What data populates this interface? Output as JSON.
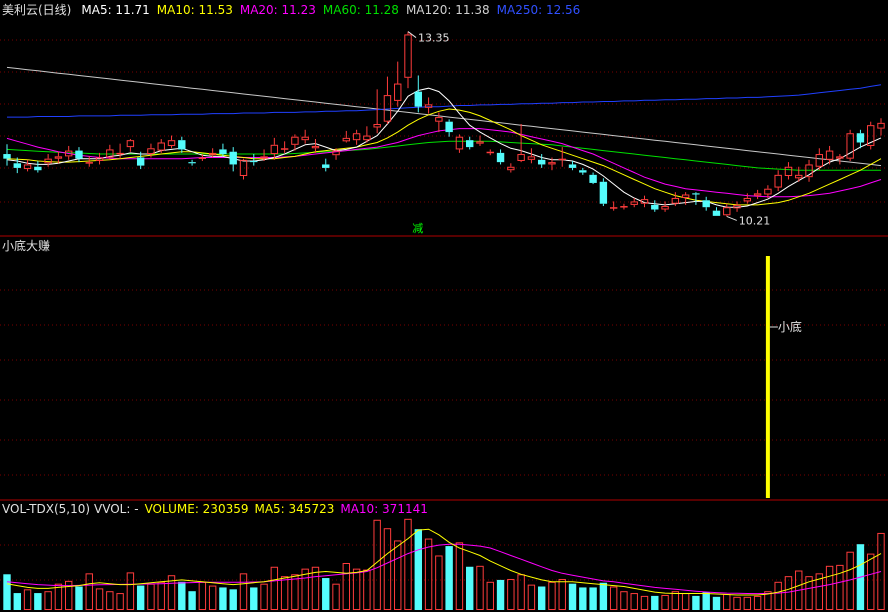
{
  "panel1": {
    "title": "美利云(日线)",
    "ma5": "MA5: 11.71",
    "ma10": "MA10: 11.53",
    "ma20": "MA20: 11.23",
    "ma60": "MA60: 11.28",
    "ma120": "MA120: 11.38",
    "ma250": "MA250: 12.56",
    "high_label": "13.35",
    "low_label": "10.21",
    "marker": "减"
  },
  "panel2": {
    "title": "小底大赚",
    "signal_label": "小底"
  },
  "panel3": {
    "name": "VOL-TDX(5,10)",
    "vvol": "VVOL: -",
    "volume": "VOLUME: 230359",
    "ma5": "MA5: 345723",
    "ma10": "MA10: 371141"
  },
  "colors": {
    "up": "#ff3c3c",
    "down": "#54fcfc",
    "ma5": "#ffffff",
    "ma10": "#ffff00",
    "ma20": "#ff00ff",
    "ma60": "#00e000",
    "ma120": "#c8c8c8",
    "ma250": "#2040ff",
    "signal": "#ffff00",
    "marker": "#00ff00",
    "border": "#b00000"
  },
  "chart_data": {
    "type": "candlestick",
    "price_range": [
      10.0,
      13.6
    ],
    "candles": [
      [
        11.28,
        11.2,
        11.45,
        11.08
      ],
      [
        11.12,
        11.04,
        11.22,
        10.95
      ],
      [
        11.02,
        11.1,
        11.18,
        10.98
      ],
      [
        11.06,
        11.0,
        11.16,
        10.96
      ],
      [
        11.12,
        11.2,
        11.28,
        11.06
      ],
      [
        11.2,
        11.24,
        11.32,
        11.12
      ],
      [
        11.24,
        11.34,
        11.42,
        11.18
      ],
      [
        11.34,
        11.2,
        11.4,
        11.14
      ],
      [
        11.12,
        11.14,
        11.24,
        11.06
      ],
      [
        11.16,
        11.22,
        11.3,
        11.1
      ],
      [
        11.22,
        11.36,
        11.44,
        11.18
      ],
      [
        11.3,
        11.3,
        11.46,
        11.2
      ],
      [
        11.4,
        11.52,
        11.54,
        11.32
      ],
      [
        11.22,
        11.08,
        11.32,
        11.02
      ],
      [
        11.28,
        11.38,
        11.46,
        11.22
      ],
      [
        11.34,
        11.48,
        11.54,
        11.3
      ],
      [
        11.42,
        11.52,
        11.6,
        11.38
      ],
      [
        11.52,
        11.36,
        11.58,
        11.3
      ],
      [
        11.14,
        11.12,
        11.18,
        11.08
      ],
      [
        11.2,
        11.22,
        11.28,
        11.16
      ],
      [
        11.26,
        11.3,
        11.38,
        11.22
      ],
      [
        11.36,
        11.28,
        11.46,
        11.24
      ],
      [
        11.32,
        11.1,
        11.4,
        10.98
      ],
      [
        10.9,
        11.18,
        11.2,
        10.84
      ],
      [
        11.16,
        11.14,
        11.28,
        11.08
      ],
      [
        11.2,
        11.24,
        11.36,
        11.16
      ],
      [
        11.28,
        11.44,
        11.56,
        11.18
      ],
      [
        11.38,
        11.38,
        11.5,
        11.3
      ],
      [
        11.44,
        11.58,
        11.62,
        11.34
      ],
      [
        11.52,
        11.58,
        11.7,
        11.46
      ],
      [
        11.38,
        11.42,
        11.54,
        11.3
      ],
      [
        11.1,
        11.04,
        11.2,
        10.98
      ],
      [
        11.26,
        11.34,
        11.38,
        11.18
      ],
      [
        11.5,
        11.56,
        11.68,
        11.48
      ],
      [
        11.52,
        11.64,
        11.7,
        11.44
      ],
      [
        11.52,
        11.6,
        11.76,
        11.48
      ],
      [
        11.74,
        11.8,
        12.4,
        11.64
      ],
      [
        11.84,
        12.3,
        12.62,
        11.8
      ],
      [
        12.2,
        12.5,
        12.88,
        12.1
      ],
      [
        12.6,
        13.35,
        13.4,
        12.42
      ],
      [
        12.36,
        12.1,
        12.64,
        12.0
      ],
      [
        12.08,
        12.14,
        12.26,
        11.98
      ],
      [
        11.84,
        11.92,
        12.0,
        11.66
      ],
      [
        11.84,
        11.66,
        11.88,
        11.58
      ],
      [
        11.36,
        11.58,
        11.62,
        11.3
      ],
      [
        11.52,
        11.4,
        11.58,
        11.36
      ],
      [
        11.46,
        11.5,
        11.6,
        11.42
      ],
      [
        11.3,
        11.32,
        11.36,
        11.26
      ],
      [
        11.3,
        11.14,
        11.36,
        11.1
      ],
      [
        11.0,
        11.06,
        11.12,
        10.96
      ],
      [
        11.16,
        11.28,
        11.8,
        11.14
      ],
      [
        11.18,
        11.24,
        11.38,
        11.12
      ],
      [
        11.18,
        11.1,
        11.28,
        11.04
      ],
      [
        11.1,
        11.14,
        11.22,
        11.0
      ],
      [
        11.2,
        11.2,
        11.4,
        11.06
      ],
      [
        11.1,
        11.04,
        11.16,
        11.0
      ],
      [
        11.0,
        10.96,
        11.04,
        10.92
      ],
      [
        10.92,
        10.78,
        10.96,
        10.76
      ],
      [
        10.8,
        10.42,
        10.86,
        10.38
      ],
      [
        10.36,
        10.36,
        10.46,
        10.3
      ],
      [
        10.36,
        10.38,
        10.42,
        10.32
      ],
      [
        10.4,
        10.46,
        10.52,
        10.36
      ],
      [
        10.42,
        10.5,
        10.56,
        10.36
      ],
      [
        10.4,
        10.32,
        10.48,
        10.28
      ],
      [
        10.32,
        10.38,
        10.46,
        10.28
      ],
      [
        10.42,
        10.52,
        10.62,
        10.38
      ],
      [
        10.52,
        10.58,
        10.62,
        10.4
      ],
      [
        10.6,
        10.58,
        10.62,
        10.4
      ],
      [
        10.48,
        10.36,
        10.54,
        10.3
      ],
      [
        10.3,
        10.21,
        10.36,
        10.21
      ],
      [
        10.22,
        10.36,
        10.42,
        10.2
      ],
      [
        10.34,
        10.4,
        10.46,
        10.28
      ],
      [
        10.46,
        10.52,
        10.6,
        10.42
      ],
      [
        10.56,
        10.6,
        10.66,
        10.5
      ],
      [
        10.58,
        10.68,
        10.74,
        10.52
      ],
      [
        10.7,
        10.92,
        11.0,
        10.64
      ],
      [
        10.9,
        11.06,
        11.14,
        10.84
      ],
      [
        10.86,
        10.92,
        11.06,
        10.8
      ],
      [
        10.88,
        11.1,
        11.18,
        10.8
      ],
      [
        11.06,
        11.28,
        11.38,
        11.0
      ],
      [
        11.18,
        11.34,
        11.42,
        11.1
      ],
      [
        11.2,
        11.24,
        11.28,
        11.1
      ],
      [
        11.2,
        11.64,
        11.7,
        11.16
      ],
      [
        11.64,
        11.48,
        11.7,
        11.38
      ],
      [
        11.42,
        11.78,
        11.84,
        11.36
      ],
      [
        11.72,
        11.82,
        11.9,
        11.6
      ]
    ],
    "ma5": [
      11.18,
      11.16,
      11.12,
      11.1,
      11.1,
      11.12,
      11.16,
      11.2,
      11.2,
      11.2,
      11.24,
      11.26,
      11.3,
      11.28,
      11.28,
      11.34,
      11.36,
      11.38,
      11.32,
      11.26,
      11.24,
      11.24,
      11.2,
      11.16,
      11.16,
      11.18,
      11.22,
      11.28,
      11.36,
      11.44,
      11.46,
      11.4,
      11.34,
      11.36,
      11.4,
      11.5,
      11.6,
      11.8,
      12.02,
      12.28,
      12.38,
      12.42,
      12.36,
      12.2,
      11.98,
      11.78,
      11.66,
      11.56,
      11.46,
      11.38,
      11.34,
      11.28,
      11.22,
      11.18,
      11.18,
      11.16,
      11.1,
      11.02,
      10.9,
      10.76,
      10.62,
      10.52,
      10.44,
      10.42,
      10.4,
      10.42,
      10.44,
      10.46,
      10.46,
      10.4,
      10.36,
      10.36,
      10.38,
      10.44,
      10.5,
      10.6,
      10.72,
      10.82,
      10.92,
      11.04,
      11.14,
      11.2,
      11.3,
      11.4,
      11.48,
      11.56
    ],
    "ma10": [
      11.2,
      11.19,
      11.18,
      11.16,
      11.15,
      11.14,
      11.14,
      11.15,
      11.16,
      11.17,
      11.18,
      11.2,
      11.22,
      11.24,
      11.26,
      11.28,
      11.3,
      11.32,
      11.32,
      11.3,
      11.28,
      11.26,
      11.24,
      11.22,
      11.2,
      11.2,
      11.2,
      11.22,
      11.24,
      11.28,
      11.32,
      11.34,
      11.36,
      11.38,
      11.4,
      11.44,
      11.48,
      11.56,
      11.66,
      11.78,
      11.88,
      11.96,
      12.02,
      12.06,
      12.04,
      12.0,
      11.94,
      11.86,
      11.78,
      11.7,
      11.6,
      11.52,
      11.44,
      11.38,
      11.32,
      11.26,
      11.2,
      11.14,
      11.08,
      11.0,
      10.92,
      10.84,
      10.76,
      10.68,
      10.62,
      10.56,
      10.52,
      10.48,
      10.46,
      10.44,
      10.42,
      10.4,
      10.4,
      10.4,
      10.42,
      10.44,
      10.48,
      10.54,
      10.6,
      10.68,
      10.76,
      10.84,
      10.92,
      11.0,
      11.1,
      11.2
    ],
    "ma20": [
      11.55,
      11.5,
      11.45,
      11.4,
      11.36,
      11.32,
      11.29,
      11.26,
      11.24,
      11.22,
      11.21,
      11.2,
      11.2,
      11.2,
      11.2,
      11.2,
      11.2,
      11.2,
      11.21,
      11.22,
      11.22,
      11.22,
      11.22,
      11.22,
      11.22,
      11.22,
      11.22,
      11.23,
      11.24,
      11.26,
      11.28,
      11.3,
      11.32,
      11.34,
      11.36,
      11.38,
      11.4,
      11.44,
      11.48,
      11.54,
      11.6,
      11.64,
      11.68,
      11.7,
      11.72,
      11.72,
      11.72,
      11.7,
      11.68,
      11.66,
      11.62,
      11.58,
      11.54,
      11.5,
      11.46,
      11.4,
      11.34,
      11.28,
      11.2,
      11.12,
      11.04,
      10.96,
      10.88,
      10.82,
      10.76,
      10.72,
      10.68,
      10.66,
      10.64,
      10.62,
      10.6,
      10.58,
      10.56,
      10.55,
      10.54,
      10.54,
      10.54,
      10.55,
      10.56,
      10.58,
      10.6,
      10.64,
      10.68,
      10.72,
      10.78,
      10.84
    ],
    "ma60": [
      11.36,
      11.35,
      11.34,
      11.33,
      11.32,
      11.31,
      11.3,
      11.3,
      11.29,
      11.28,
      11.28,
      11.28,
      11.28,
      11.28,
      11.28,
      11.28,
      11.28,
      11.28,
      11.28,
      11.28,
      11.28,
      11.28,
      11.28,
      11.28,
      11.28,
      11.28,
      11.28,
      11.28,
      11.29,
      11.3,
      11.31,
      11.32,
      11.33,
      11.34,
      11.35,
      11.36,
      11.38,
      11.4,
      11.42,
      11.44,
      11.46,
      11.48,
      11.49,
      11.5,
      11.5,
      11.5,
      11.5,
      11.5,
      11.49,
      11.48,
      11.47,
      11.46,
      11.45,
      11.44,
      11.42,
      11.4,
      11.38,
      11.36,
      11.34,
      11.32,
      11.3,
      11.28,
      11.26,
      11.24,
      11.22,
      11.2,
      11.18,
      11.16,
      11.14,
      11.12,
      11.1,
      11.08,
      11.06,
      11.04,
      11.03,
      11.02,
      11.01,
      11.0,
      11.0,
      11.0,
      11.0,
      11.0,
      11.0,
      11.0,
      11.0,
      11.0
    ],
    "ma120": [
      12.78,
      12.76,
      12.74,
      12.72,
      12.7,
      12.68,
      12.66,
      12.64,
      12.62,
      12.6,
      12.58,
      12.56,
      12.54,
      12.52,
      12.5,
      12.48,
      12.46,
      12.44,
      12.42,
      12.4,
      12.38,
      12.36,
      12.34,
      12.32,
      12.3,
      12.28,
      12.26,
      12.24,
      12.22,
      12.2,
      12.18,
      12.16,
      12.14,
      12.12,
      12.1,
      12.08,
      12.06,
      12.04,
      12.02,
      12.0,
      11.98,
      11.96,
      11.94,
      11.92,
      11.9,
      11.88,
      11.86,
      11.84,
      11.82,
      11.8,
      11.78,
      11.76,
      11.74,
      11.72,
      11.7,
      11.68,
      11.66,
      11.64,
      11.62,
      11.6,
      11.58,
      11.56,
      11.54,
      11.52,
      11.5,
      11.48,
      11.46,
      11.44,
      11.42,
      11.4,
      11.38,
      11.36,
      11.34,
      11.32,
      11.3,
      11.28,
      11.26,
      11.24,
      11.22,
      11.2,
      11.18,
      11.16,
      11.14,
      11.12,
      11.1,
      11.08
    ],
    "ma250": [
      11.92,
      11.92,
      11.92,
      11.93,
      11.93,
      11.93,
      11.93,
      11.94,
      11.94,
      11.94,
      11.94,
      11.95,
      11.95,
      11.95,
      11.96,
      11.96,
      11.96,
      11.97,
      11.97,
      11.97,
      11.98,
      11.98,
      11.98,
      11.99,
      11.99,
      11.99,
      12.0,
      12.0,
      12.0,
      12.01,
      12.01,
      12.02,
      12.02,
      12.03,
      12.03,
      12.04,
      12.05,
      12.06,
      12.07,
      12.08,
      12.09,
      12.1,
      12.1,
      12.11,
      12.12,
      12.12,
      12.13,
      12.13,
      12.14,
      12.14,
      12.15,
      12.15,
      12.16,
      12.16,
      12.17,
      12.17,
      12.18,
      12.18,
      12.19,
      12.19,
      12.2,
      12.2,
      12.21,
      12.21,
      12.22,
      12.22,
      12.23,
      12.23,
      12.24,
      12.24,
      12.25,
      12.25,
      12.26,
      12.26,
      12.27,
      12.28,
      12.29,
      12.3,
      12.32,
      12.34,
      12.36,
      12.38,
      12.4,
      12.42,
      12.45,
      12.48
    ],
    "signal_index": 74,
    "marker_index": 40,
    "volume_range": [
      0,
      1000000
    ],
    "volume": [
      380000,
      180000,
      220000,
      180000,
      200000,
      280000,
      310000,
      250000,
      390000,
      230000,
      200000,
      180000,
      400000,
      260000,
      280000,
      300000,
      370000,
      300000,
      200000,
      300000,
      260000,
      240000,
      220000,
      390000,
      240000,
      280000,
      460000,
      360000,
      380000,
      440000,
      460000,
      340000,
      280000,
      500000,
      440000,
      430000,
      960000,
      870000,
      740000,
      970000,
      860000,
      760000,
      580000,
      680000,
      720000,
      460000,
      470000,
      300000,
      320000,
      330000,
      380000,
      270000,
      250000,
      300000,
      330000,
      280000,
      240000,
      240000,
      290000,
      250000,
      200000,
      180000,
      150000,
      150000,
      160000,
      200000,
      180000,
      150000,
      190000,
      140000,
      170000,
      140000,
      140000,
      150000,
      200000,
      300000,
      360000,
      420000,
      360000,
      390000,
      470000,
      480000,
      620000,
      700000,
      600000,
      820000
    ],
    "vol_ma5": [
      280000,
      260000,
      240000,
      230000,
      230000,
      240000,
      250000,
      260000,
      280000,
      290000,
      280000,
      270000,
      270000,
      280000,
      290000,
      300000,
      310000,
      320000,
      310000,
      300000,
      290000,
      280000,
      270000,
      280000,
      290000,
      300000,
      320000,
      340000,
      360000,
      380000,
      400000,
      410000,
      400000,
      390000,
      400000,
      420000,
      510000,
      600000,
      680000,
      760000,
      850000,
      860000,
      800000,
      720000,
      660000,
      620000,
      580000,
      520000,
      470000,
      420000,
      380000,
      350000,
      320000,
      300000,
      300000,
      300000,
      290000,
      280000,
      270000,
      260000,
      250000,
      230000,
      210000,
      190000,
      180000,
      175000,
      175000,
      175000,
      175000,
      170000,
      165000,
      160000,
      160000,
      160000,
      170000,
      190000,
      220000,
      260000,
      300000,
      330000,
      360000,
      390000,
      430000,
      480000,
      540000,
      600000
    ],
    "vol_ma10": [
      300000,
      290000,
      280000,
      270000,
      265000,
      260000,
      260000,
      262000,
      265000,
      268000,
      270000,
      272000,
      274000,
      276000,
      278000,
      280000,
      284000,
      288000,
      292000,
      295000,
      295000,
      295000,
      295000,
      296000,
      298000,
      300000,
      310000,
      320000,
      330000,
      340000,
      355000,
      365000,
      375000,
      385000,
      395000,
      410000,
      450000,
      500000,
      550000,
      600000,
      640000,
      670000,
      690000,
      700000,
      700000,
      690000,
      680000,
      660000,
      620000,
      580000,
      540000,
      500000,
      460000,
      420000,
      390000,
      370000,
      350000,
      330000,
      310000,
      300000,
      285000,
      270000,
      255000,
      240000,
      230000,
      220000,
      210000,
      200000,
      192000,
      185000,
      180000,
      178000,
      176000,
      174000,
      175000,
      180000,
      190000,
      210000,
      230000,
      250000,
      270000,
      295000,
      320000,
      350000,
      380000,
      410000
    ]
  }
}
